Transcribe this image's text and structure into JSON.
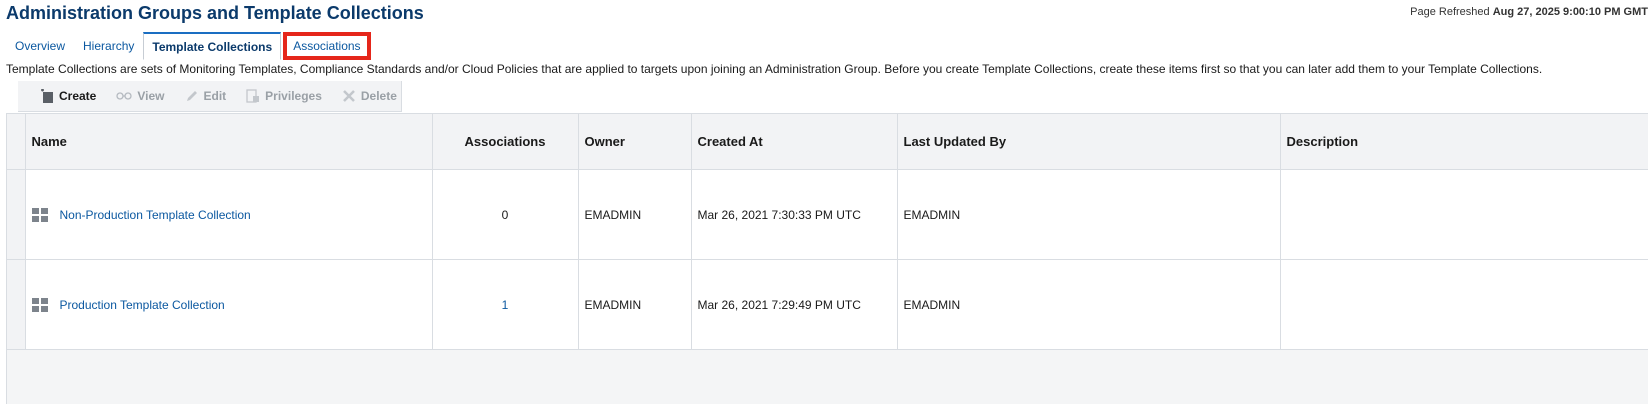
{
  "header": {
    "title": "Administration Groups and Template Collections",
    "refresh_label": "Page Refreshed",
    "refresh_value": "Aug 27, 2025 9:00:10 PM GMT"
  },
  "tabs": [
    {
      "label": "Overview"
    },
    {
      "label": "Hierarchy"
    },
    {
      "label": "Template Collections"
    },
    {
      "label": "Associations"
    }
  ],
  "description": "Template Collections are sets of Monitoring Templates, Compliance Standards and/or Cloud Policies that are applied to targets upon joining an Administration Group. Before you create Template Collections, create these items first so that you can later add them to your Template Collections.",
  "toolbar": {
    "create": "Create",
    "view": "View",
    "edit": "Edit",
    "privileges": "Privileges",
    "delete": "Delete"
  },
  "table": {
    "headers": {
      "name": "Name",
      "associations": "Associations",
      "owner": "Owner",
      "created_at": "Created At",
      "last_updated_by": "Last Updated By",
      "description": "Description"
    },
    "rows": [
      {
        "name": "Non-Production Template Collection",
        "associations": "0",
        "owner": "EMADMIN",
        "created_at": "Mar 26, 2021 7:30:33 PM UTC",
        "last_updated_by": "EMADMIN",
        "description": ""
      },
      {
        "name": "Production Template Collection",
        "associations": "1",
        "owner": "EMADMIN",
        "created_at": "Mar 26, 2021 7:29:49 PM UTC",
        "last_updated_by": "EMADMIN",
        "description": ""
      }
    ]
  },
  "colors": {
    "title": "#0b3a6b",
    "link": "#0b58a0",
    "highlight_box": "#e5261a",
    "active_tab_border": "#1a6ec2"
  }
}
